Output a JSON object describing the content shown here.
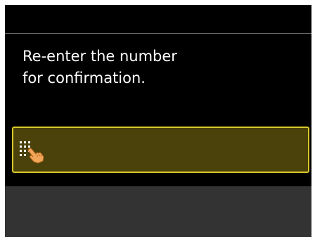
{
  "message": {
    "line1": "Re-enter the number",
    "line2": "for confirmation."
  },
  "input": {
    "icon": "keypad-tap-icon"
  },
  "colors": {
    "screen_background": "#000000",
    "text": "#ffffff",
    "input_fill": "#4a420a",
    "input_border": "#d8c82a",
    "bottom_area": "#333333",
    "divider": "#6e6e6e"
  }
}
